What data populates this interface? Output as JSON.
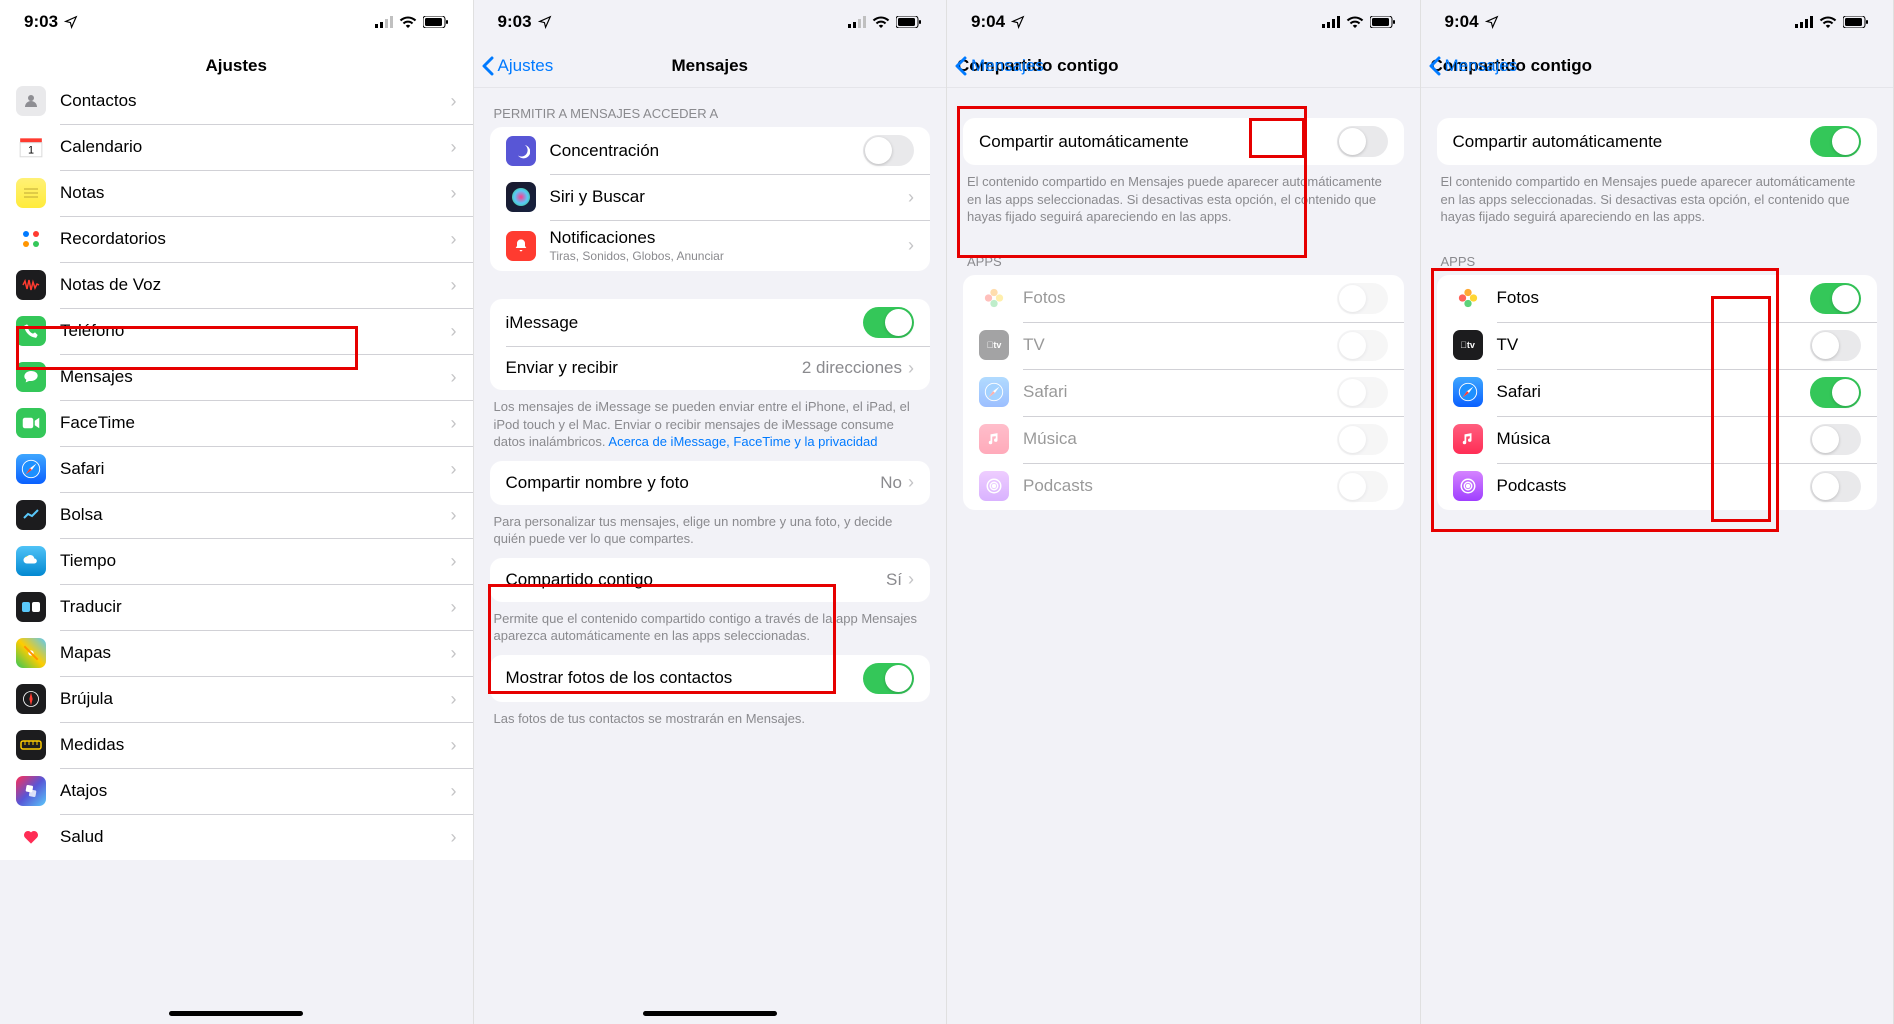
{
  "status": {
    "time_a": "9:03",
    "time_b": "9:04"
  },
  "p1": {
    "title": "Ajustes",
    "rows": [
      {
        "label": "Contactos",
        "icon": "contacts"
      },
      {
        "label": "Calendario",
        "icon": "calendar"
      },
      {
        "label": "Notas",
        "icon": "notes"
      },
      {
        "label": "Recordatorios",
        "icon": "reminders"
      },
      {
        "label": "Notas de Voz",
        "icon": "voice"
      },
      {
        "label": "Teléfono",
        "icon": "phone"
      },
      {
        "label": "Mensajes",
        "icon": "messages"
      },
      {
        "label": "FaceTime",
        "icon": "facetime"
      },
      {
        "label": "Safari",
        "icon": "safari"
      },
      {
        "label": "Bolsa",
        "icon": "stocks"
      },
      {
        "label": "Tiempo",
        "icon": "weather"
      },
      {
        "label": "Traducir",
        "icon": "translate"
      },
      {
        "label": "Mapas",
        "icon": "maps"
      },
      {
        "label": "Brújula",
        "icon": "compass"
      },
      {
        "label": "Medidas",
        "icon": "measure"
      },
      {
        "label": "Atajos",
        "icon": "shortcuts"
      },
      {
        "label": "Salud",
        "icon": "health"
      }
    ]
  },
  "p2": {
    "back": "Ajustes",
    "title": "Mensajes",
    "section_permit": "PERMITIR A MENSAJES ACCEDER A",
    "focus": "Concentración",
    "siri": "Siri y Buscar",
    "notif": "Notificaciones",
    "notif_sub": "Tiras, Sonidos, Globos, Anunciar",
    "imessage": "iMessage",
    "send_recv": "Enviar y recibir",
    "send_recv_val": "2 direcciones",
    "imessage_footer": "Los mensajes de iMessage se pueden enviar entre el iPhone, el iPad, el iPod touch y el Mac. Enviar o recibir mensajes de iMessage consume datos inalámbricos. ",
    "imessage_link": "Acerca de iMessage, FaceTime y la privacidad",
    "share_name": "Compartir nombre y foto",
    "share_name_val": "No",
    "share_name_footer": "Para personalizar tus mensajes, elige un nombre y una foto, y decide quién puede ver lo que compartes.",
    "shared_with_you": "Compartido contigo",
    "shared_with_you_val": "Sí",
    "shared_with_you_footer": "Permite que el contenido compartido contigo a través de la app Mensajes aparezca automáticamente en las apps seleccionadas.",
    "show_photos": "Mostrar fotos de los contactos",
    "show_photos_footer": "Las fotos de tus contactos se mostrarán en Mensajes."
  },
  "p34": {
    "back": "Mensajes",
    "title": "Compartido contigo",
    "auto": "Compartir automáticamente",
    "auto_footer": "El contenido compartido en Mensajes puede aparecer automáticamente en las apps seleccionadas. Si desactivas esta opción, el contenido que hayas fijado seguirá apareciendo en las apps.",
    "apps_header": "APPS",
    "apps": [
      {
        "label": "Fotos",
        "icon": "photos",
        "p3": false,
        "p4": true
      },
      {
        "label": "TV",
        "icon": "tv",
        "p3": false,
        "p4": false
      },
      {
        "label": "Safari",
        "icon": "safari",
        "p3": false,
        "p4": true
      },
      {
        "label": "Música",
        "icon": "music",
        "p3": false,
        "p4": false
      },
      {
        "label": "Podcasts",
        "icon": "podcasts",
        "p3": false,
        "p4": false
      }
    ]
  }
}
